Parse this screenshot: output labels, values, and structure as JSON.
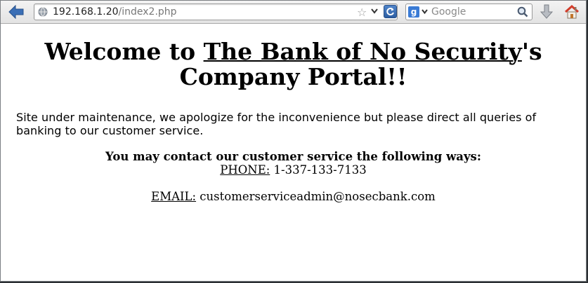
{
  "browser": {
    "url_host": "192.168.1.20",
    "url_path": "/index2.php",
    "search_placeholder": "Google",
    "search_engine_letter": "g"
  },
  "page": {
    "title_prefix": "Welcome to ",
    "title_bank": "The Bank of No Security",
    "title_suffix": "'s Company Portal!!",
    "maintenance": "Site under maintenance, we apologize for the inconvenience but please direct all queries of banking to our customer service.",
    "contact_heading": "You may contact our customer service the following ways:",
    "phone_label": "PHONE:",
    "phone_value": " 1-337-133-7133",
    "email_label": "EMAIL:",
    "email_value": " customerserviceadmin@nosecbank.com"
  },
  "colors": {
    "back_arrow": "#3b6fb6",
    "reload": "#2c5ea3",
    "home_roof": "#d23c2a"
  }
}
